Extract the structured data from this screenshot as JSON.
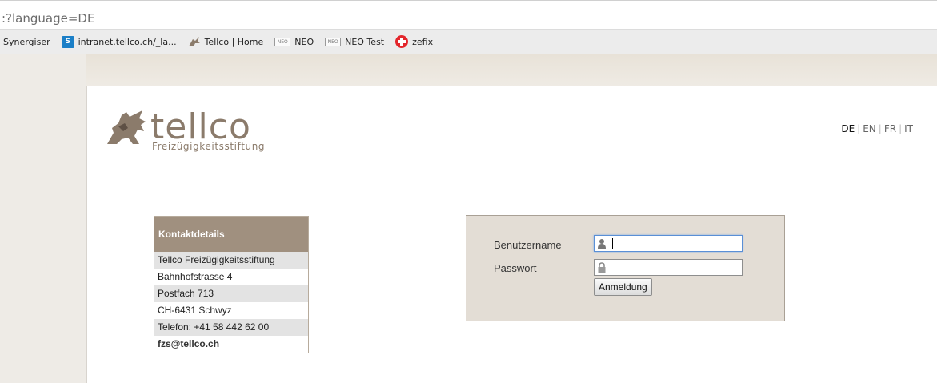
{
  "browser": {
    "url": ":?language=DE",
    "bookmarks": [
      {
        "label": "Synergiser",
        "icon": "none"
      },
      {
        "label": "intranet.tellco.ch/_la...",
        "icon": "sharepoint-icon"
      },
      {
        "label": "Tellco | Home",
        "icon": "tellco-icon"
      },
      {
        "label": "NEO",
        "icon": "neo-icon"
      },
      {
        "label": "NEO Test",
        "icon": "neo-icon"
      },
      {
        "label": "zefix",
        "icon": "swiss-cross-icon"
      }
    ]
  },
  "logo": {
    "word": "tellco",
    "subtitle": "Freizügigkeitsstiftung"
  },
  "languages": {
    "items": [
      "DE",
      "EN",
      "FR",
      "IT"
    ],
    "active": "DE"
  },
  "contact": {
    "header": "Kontaktdetails",
    "rows": [
      "Tellco Freizügigkeitsstiftung",
      "Bahnhofstrasse 4",
      "Postfach 713",
      "CH-6431 Schwyz",
      "Telefon: +41 58 442 62 00",
      "fzs@tellco.ch"
    ]
  },
  "login": {
    "username_label": "Benutzername",
    "password_label": "Passwort",
    "username_value": "",
    "password_value": "",
    "submit_label": "Anmeldung"
  },
  "colors": {
    "brand": "#8b7b6b",
    "contact_header": "#a0907f",
    "login_bg": "#e3ddd5"
  }
}
